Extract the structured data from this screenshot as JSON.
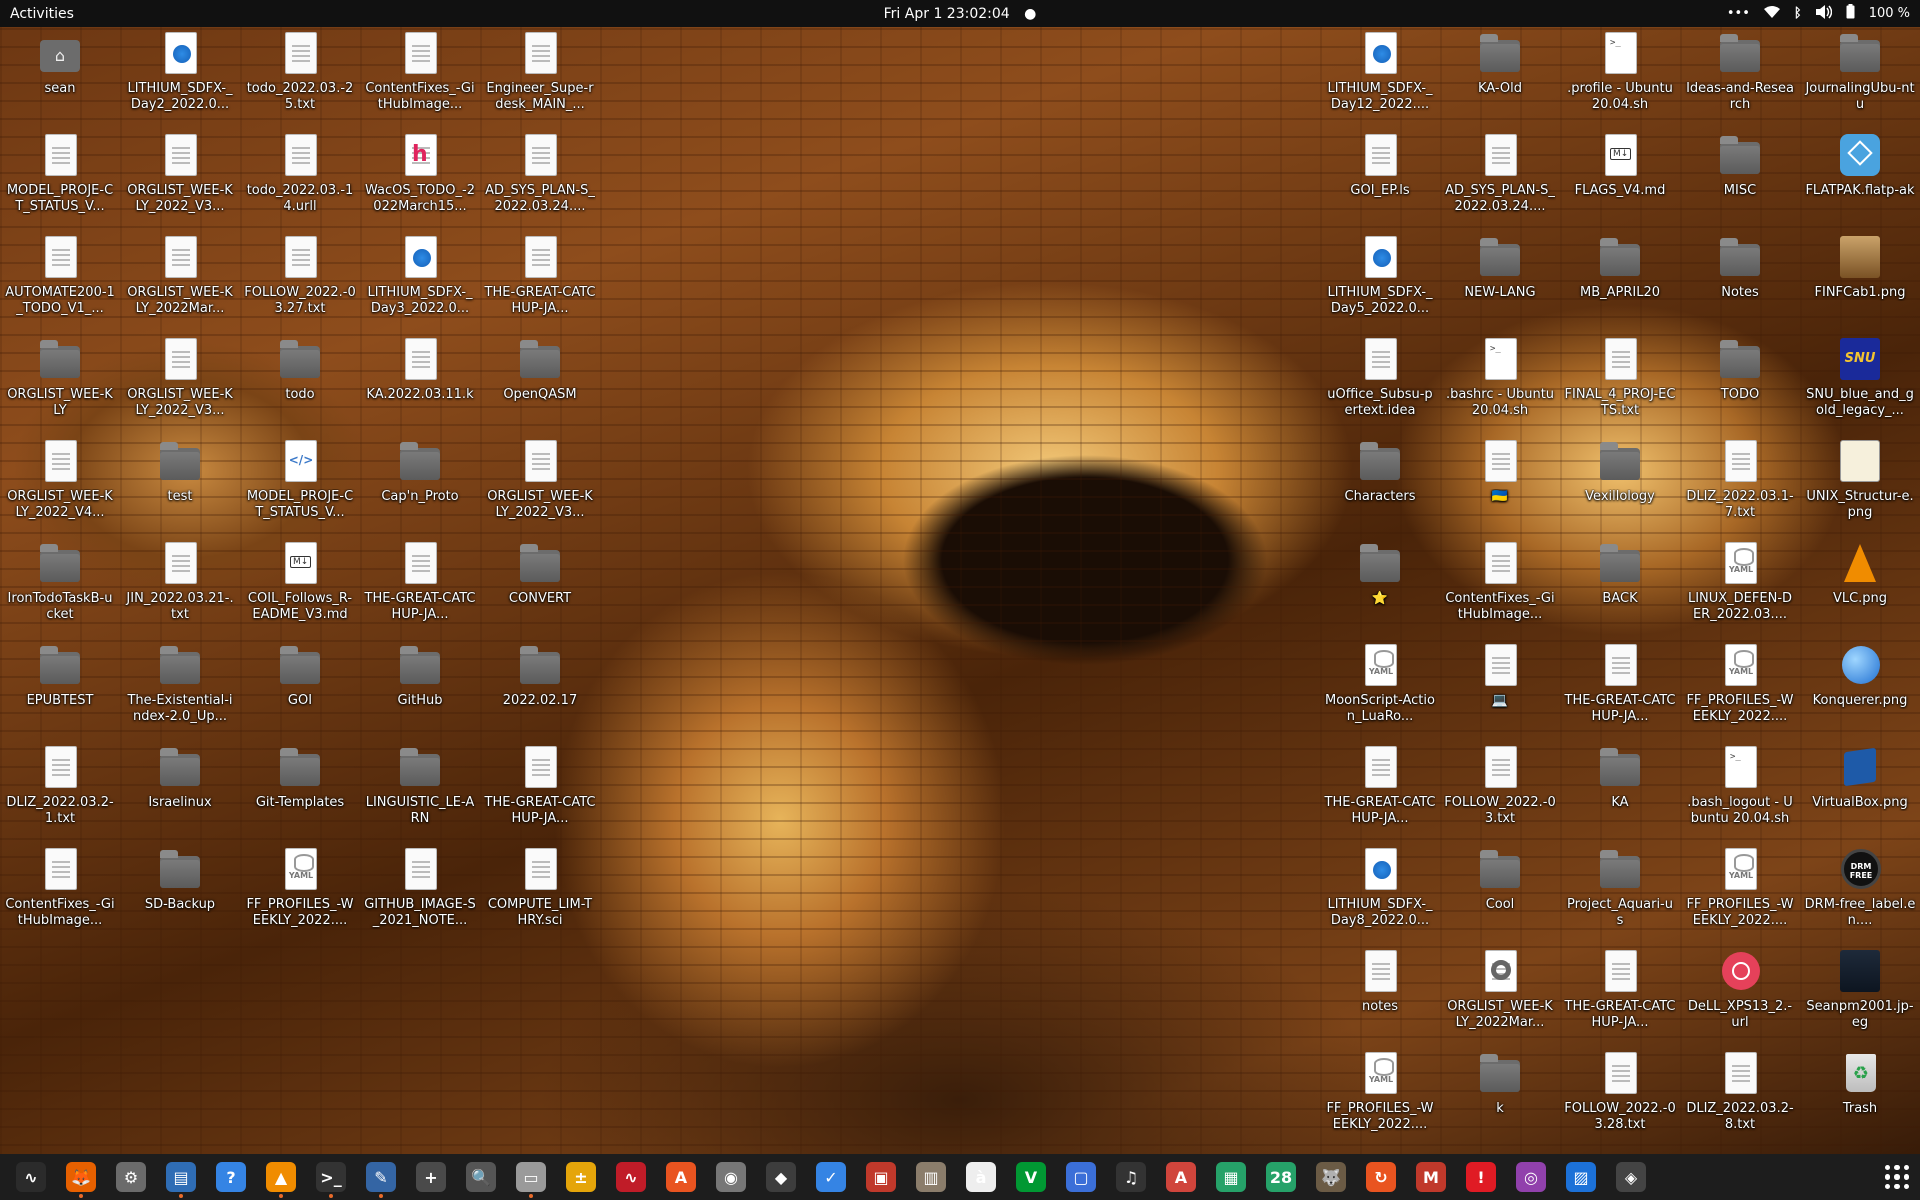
{
  "topbar": {
    "activities": "Activities",
    "clock": "Fri Apr 1  23:02:04",
    "battery": "100 %"
  },
  "desktop_icons_left": [
    {
      "label": "sean",
      "type": "home"
    },
    {
      "label": "LITHIUM_SDFX-_Day2_2022.0...",
      "type": "webloc"
    },
    {
      "label": "todo_2022.03.-25.txt",
      "type": "doc"
    },
    {
      "label": "ContentFixes_-GitHubImage...",
      "type": "doc"
    },
    {
      "label": "Engineer_Supe-rdesk_MAIN_...",
      "type": "doc"
    },
    {
      "label": "MODEL_PROJE-CT_STATUS_V...",
      "type": "doc"
    },
    {
      "label": "ORGLIST_WEE-KLY_2022_V3...",
      "type": "doc"
    },
    {
      "label": "todo_2022.03.-14.urll",
      "type": "doc"
    },
    {
      "label": "WacOS_TODO_-2022March15...",
      "type": "h"
    },
    {
      "label": "AD_SYS_PLAN-S_2022.03.24....",
      "type": "doc"
    },
    {
      "label": "AUTOMATE200-1_TODO_V1_...",
      "type": "doc"
    },
    {
      "label": "ORGLIST_WEE-KLY_2022Mar...",
      "type": "doc"
    },
    {
      "label": "FOLLOW_2022.-03.27.txt",
      "type": "doc"
    },
    {
      "label": "LITHIUM_SDFX-_Day3_2022.0...",
      "type": "webloc"
    },
    {
      "label": "THE-GREAT-CATCHUP-JA...",
      "type": "doc"
    },
    {
      "label": "ORGLIST_WEE-KLY",
      "type": "folder"
    },
    {
      "label": "ORGLIST_WEE-KLY_2022_V3...",
      "type": "doc"
    },
    {
      "label": "todo",
      "type": "folder"
    },
    {
      "label": "KA.2022.03.11.k",
      "type": "doc"
    },
    {
      "label": "OpenQASM",
      "type": "folder"
    },
    {
      "label": "ORGLIST_WEE-KLY_2022_V4...",
      "type": "doc"
    },
    {
      "label": "test",
      "type": "folder"
    },
    {
      "label": "MODEL_PROJE-CT_STATUS_V...",
      "type": "code"
    },
    {
      "label": "Cap'n_Proto",
      "type": "folder"
    },
    {
      "label": "ORGLIST_WEE-KLY_2022_V3...",
      "type": "doc"
    },
    {
      "label": "IronTodoTaskB-ucket",
      "type": "folder"
    },
    {
      "label": "JIN_2022.03.21-.txt",
      "type": "doc"
    },
    {
      "label": "COIL_Follows_R-EADME_V3.md",
      "type": "md"
    },
    {
      "label": "THE-GREAT-CATCHUP-JA...",
      "type": "doc"
    },
    {
      "label": "CONVERT",
      "type": "folder"
    },
    {
      "label": "EPUBTEST",
      "type": "folder"
    },
    {
      "label": "The-Existential-index-2.0_Up...",
      "type": "folder"
    },
    {
      "label": "GOI",
      "type": "folder"
    },
    {
      "label": "GitHub",
      "type": "folder"
    },
    {
      "label": "2022.02.17",
      "type": "folder"
    },
    {
      "label": "DLIZ_2022.03.2-1.txt",
      "type": "doc"
    },
    {
      "label": "Israelinux",
      "type": "folder"
    },
    {
      "label": "Git-Templates",
      "type": "folder"
    },
    {
      "label": "LINGUISTIC_LE-ARN",
      "type": "folder"
    },
    {
      "label": "THE-GREAT-CATCHUP-JA...",
      "type": "doc"
    },
    {
      "label": "ContentFixes_-GitHubImage...",
      "type": "doc"
    },
    {
      "label": "SD-Backup",
      "type": "folder"
    },
    {
      "label": "FF_PROFILES_-WEEKLY_2022....",
      "type": "yaml"
    },
    {
      "label": "GITHUB_IMAGE-S_2021_NOTE...",
      "type": "doc"
    },
    {
      "label": "COMPUTE_LIM-THRY.sci",
      "type": "doc"
    }
  ],
  "desktop_icons_right": [
    {
      "label": "LITHIUM_SDFX-_Day12_2022....",
      "type": "webloc"
    },
    {
      "label": "KA-Old",
      "type": "folder"
    },
    {
      "label": ".profile - Ubuntu 20.04.sh",
      "type": "term"
    },
    {
      "label": "Ideas-and-Research",
      "type": "folder"
    },
    {
      "label": "JournalingUbu-ntu",
      "type": "folder"
    },
    {
      "label": "GOI_EP.ls",
      "type": "doc"
    },
    {
      "label": "AD_SYS_PLAN-S_2022.03.24....",
      "type": "doc"
    },
    {
      "label": "FLAGS_V4.md",
      "type": "md"
    },
    {
      "label": "MISC",
      "type": "folder"
    },
    {
      "label": "FLATPAK.flatp-ak",
      "type": "flatpak"
    },
    {
      "label": "LITHIUM_SDFX-_Day5_2022.0...",
      "type": "webloc"
    },
    {
      "label": "NEW-LANG",
      "type": "folder"
    },
    {
      "label": "MB_APRIL20",
      "type": "folder"
    },
    {
      "label": "Notes",
      "type": "folder"
    },
    {
      "label": "FINFCab1.png",
      "type": "img-cab"
    },
    {
      "label": "uOffice_Subsu-pertext.idea",
      "type": "doc"
    },
    {
      "label": ".bashrc - Ubuntu 20.04.sh",
      "type": "term"
    },
    {
      "label": "FINAL_4_PROJ-ECTS.txt",
      "type": "doc"
    },
    {
      "label": "TODO",
      "type": "folder"
    },
    {
      "label": "SNU_blue_and_gold_legacy_...",
      "type": "img-snu"
    },
    {
      "label": "Characters",
      "type": "folder"
    },
    {
      "label": "🇺🇦",
      "type": "doc"
    },
    {
      "label": "Vexillology",
      "type": "folder"
    },
    {
      "label": "DLIZ_2022.03.1-7.txt",
      "type": "doc"
    },
    {
      "label": "UNIX_Structur-e.png",
      "type": "img-unix"
    },
    {
      "label": "⭐",
      "type": "folder"
    },
    {
      "label": "ContentFixes_-GitHubImage...",
      "type": "doc"
    },
    {
      "label": "BACK",
      "type": "folder"
    },
    {
      "label": "LINUX_DEFEN-DER_2022.03....",
      "type": "yaml"
    },
    {
      "label": "VLC.png",
      "type": "img-vlc"
    },
    {
      "label": "MoonScript-Action_LuaRo...",
      "type": "yaml"
    },
    {
      "label": "💻",
      "type": "doc"
    },
    {
      "label": "THE-GREAT-CATCHUP-JA...",
      "type": "doc"
    },
    {
      "label": "FF_PROFILES_-WEEKLY_2022....",
      "type": "yaml"
    },
    {
      "label": "Konquerer.png",
      "type": "img-konq"
    },
    {
      "label": "THE-GREAT-CATCHUP-JA...",
      "type": "doc"
    },
    {
      "label": "FOLLOW_2022.-03.txt",
      "type": "doc"
    },
    {
      "label": "KA",
      "type": "folder"
    },
    {
      "label": ".bash_logout - Ubuntu 20.04.sh",
      "type": "term"
    },
    {
      "label": "VirtualBox.png",
      "type": "img-vbox"
    },
    {
      "label": "LITHIUM_SDFX-_Day8_2022.0...",
      "type": "webloc"
    },
    {
      "label": "Cool",
      "type": "folder"
    },
    {
      "label": "Project_Aquari-us",
      "type": "folder"
    },
    {
      "label": "FF_PROFILES_-WEEKLY_2022....",
      "type": "yaml"
    },
    {
      "label": "DRM-free_label.en....",
      "type": "img-drm"
    },
    {
      "label": "notes",
      "type": "doc"
    },
    {
      "label": "ORGLIST_WEE-KLY_2022Mar...",
      "type": "disc"
    },
    {
      "label": "THE-GREAT-CATCHUP-JA...",
      "type": "doc"
    },
    {
      "label": "DeLL_XPS13_2.-url",
      "type": "noentry"
    },
    {
      "label": "Seanpm2001.jp-eg",
      "type": "img-photo"
    },
    {
      "label": "FF_PROFILES_-WEEKLY_2022....",
      "type": "yaml"
    },
    {
      "label": "k",
      "type": "folder"
    },
    {
      "label": "FOLLOW_2022.-03.28.txt",
      "type": "doc"
    },
    {
      "label": "DLIZ_2022.03.2-8.txt",
      "type": "doc"
    },
    {
      "label": "Trash",
      "type": "trash"
    }
  ],
  "dock": [
    {
      "name": "system-monitor",
      "color": "#2b2b2b",
      "glyph": "∿",
      "running": false
    },
    {
      "name": "firefox",
      "color": "#e66000",
      "glyph": "🦊",
      "running": true
    },
    {
      "name": "settings",
      "color": "#6b6b6b",
      "glyph": "⚙",
      "running": false
    },
    {
      "name": "document-viewer",
      "color": "#2f6db5",
      "glyph": "▤",
      "running": true
    },
    {
      "name": "help",
      "color": "#3584e4",
      "glyph": "?",
      "running": false
    },
    {
      "name": "vlc",
      "color": "#f08c00",
      "glyph": "▲",
      "running": true
    },
    {
      "name": "terminal",
      "color": "#333333",
      "glyph": ">_",
      "running": true
    },
    {
      "name": "text-editor",
      "color": "#3465a4",
      "glyph": "✎",
      "running": true
    },
    {
      "name": "gnome-extension",
      "color": "#4a4a4a",
      "glyph": "+",
      "running": false
    },
    {
      "name": "image-viewer",
      "color": "#555555",
      "glyph": "🔍",
      "running": false
    },
    {
      "name": "files",
      "color": "#9a9a9a",
      "glyph": "▭",
      "running": true
    },
    {
      "name": "calculator",
      "color": "#e5a50a",
      "glyph": "±",
      "running": false
    },
    {
      "name": "system-monitor-2",
      "color": "#c01c28",
      "glyph": "∿",
      "running": false
    },
    {
      "name": "software",
      "color": "#e95420",
      "glyph": "A",
      "running": false
    },
    {
      "name": "disks",
      "color": "#777777",
      "glyph": "◉",
      "running": false
    },
    {
      "name": "inkscape",
      "color": "#3d3d3d",
      "glyph": "◆",
      "running": false
    },
    {
      "name": "tasks",
      "color": "#3584e4",
      "glyph": "✓",
      "running": false
    },
    {
      "name": "screenshot",
      "color": "#c0392b",
      "glyph": "▣",
      "running": false
    },
    {
      "name": "archive-manager",
      "color": "#8b7d6b",
      "glyph": "▥",
      "running": false
    },
    {
      "name": "character-map",
      "color": "#eeeeee",
      "glyph": "à",
      "running": false
    },
    {
      "name": "vim",
      "color": "#019833",
      "glyph": "V",
      "running": false
    },
    {
      "name": "workspaces",
      "color": "#3b6fd8",
      "glyph": "▢",
      "running": false
    },
    {
      "name": "music",
      "color": "#333333",
      "glyph": "♫",
      "running": false
    },
    {
      "name": "pdf-viewer",
      "color": "#d0453c",
      "glyph": "A",
      "running": false
    },
    {
      "name": "spreadsheet",
      "color": "#26a269",
      "glyph": "▦",
      "running": false
    },
    {
      "name": "calendar",
      "color": "#26a269",
      "glyph": "28",
      "running": false
    },
    {
      "name": "gimp",
      "color": "#6b5b45",
      "glyph": "🐺",
      "running": false
    },
    {
      "name": "update-manager",
      "color": "#e95420",
      "glyph": "↻",
      "running": false
    },
    {
      "name": "mario-game",
      "color": "#c0392b",
      "glyph": "M",
      "running": false
    },
    {
      "name": "error-reporter",
      "color": "#e01b24",
      "glyph": "!",
      "running": false
    },
    {
      "name": "cheese",
      "color": "#9141ac",
      "glyph": "◎",
      "running": false
    },
    {
      "name": "remote-desktop",
      "color": "#1c71d8",
      "glyph": "▨",
      "running": false
    },
    {
      "name": "inkscape-2",
      "color": "#444444",
      "glyph": "◈",
      "running": false
    }
  ]
}
